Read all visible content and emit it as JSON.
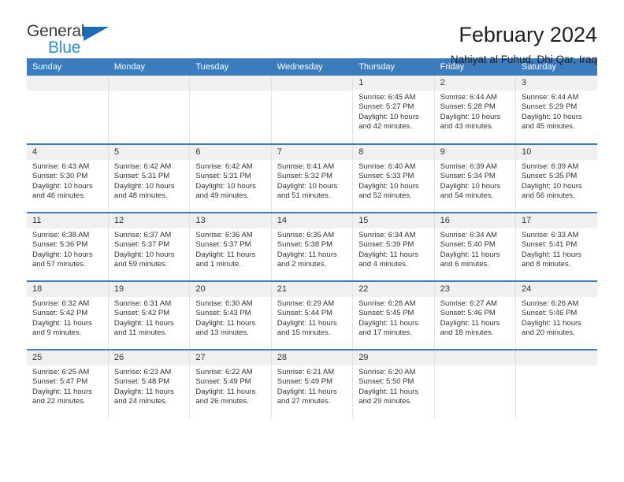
{
  "brand": {
    "name_top": "General",
    "name_bottom": "Blue",
    "accent_dark": "#1d6cb5",
    "accent_light": "#2b8fd8"
  },
  "header": {
    "title": "February 2024",
    "subtitle": "Nahiyat al Fuhud, Dhi Qar, Iraq"
  },
  "theme": {
    "header_blue": "#3a7cbe",
    "daynum_band": "#f0f0f0",
    "text": "#333333"
  },
  "calendar": {
    "weekday_headers": [
      "Sunday",
      "Monday",
      "Tuesday",
      "Wednesday",
      "Thursday",
      "Friday",
      "Saturday"
    ],
    "weeks": [
      [
        {
          "day": "",
          "empty": true
        },
        {
          "day": "",
          "empty": true
        },
        {
          "day": "",
          "empty": true
        },
        {
          "day": "",
          "empty": true
        },
        {
          "day": "1",
          "sunrise": "Sunrise: 6:45 AM",
          "sunset": "Sunset: 5:27 PM",
          "daylight": "Daylight: 10 hours and 42 minutes."
        },
        {
          "day": "2",
          "sunrise": "Sunrise: 6:44 AM",
          "sunset": "Sunset: 5:28 PM",
          "daylight": "Daylight: 10 hours and 43 minutes."
        },
        {
          "day": "3",
          "sunrise": "Sunrise: 6:44 AM",
          "sunset": "Sunset: 5:29 PM",
          "daylight": "Daylight: 10 hours and 45 minutes."
        }
      ],
      [
        {
          "day": "4",
          "sunrise": "Sunrise: 6:43 AM",
          "sunset": "Sunset: 5:30 PM",
          "daylight": "Daylight: 10 hours and 46 minutes."
        },
        {
          "day": "5",
          "sunrise": "Sunrise: 6:42 AM",
          "sunset": "Sunset: 5:31 PM",
          "daylight": "Daylight: 10 hours and 48 minutes."
        },
        {
          "day": "6",
          "sunrise": "Sunrise: 6:42 AM",
          "sunset": "Sunset: 5:31 PM",
          "daylight": "Daylight: 10 hours and 49 minutes."
        },
        {
          "day": "7",
          "sunrise": "Sunrise: 6:41 AM",
          "sunset": "Sunset: 5:32 PM",
          "daylight": "Daylight: 10 hours and 51 minutes."
        },
        {
          "day": "8",
          "sunrise": "Sunrise: 6:40 AM",
          "sunset": "Sunset: 5:33 PM",
          "daylight": "Daylight: 10 hours and 52 minutes."
        },
        {
          "day": "9",
          "sunrise": "Sunrise: 6:39 AM",
          "sunset": "Sunset: 5:34 PM",
          "daylight": "Daylight: 10 hours and 54 minutes."
        },
        {
          "day": "10",
          "sunrise": "Sunrise: 6:39 AM",
          "sunset": "Sunset: 5:35 PM",
          "daylight": "Daylight: 10 hours and 56 minutes."
        }
      ],
      [
        {
          "day": "11",
          "sunrise": "Sunrise: 6:38 AM",
          "sunset": "Sunset: 5:36 PM",
          "daylight": "Daylight: 10 hours and 57 minutes."
        },
        {
          "day": "12",
          "sunrise": "Sunrise: 6:37 AM",
          "sunset": "Sunset: 5:37 PM",
          "daylight": "Daylight: 10 hours and 59 minutes."
        },
        {
          "day": "13",
          "sunrise": "Sunrise: 6:36 AM",
          "sunset": "Sunset: 5:37 PM",
          "daylight": "Daylight: 11 hours and 1 minute."
        },
        {
          "day": "14",
          "sunrise": "Sunrise: 6:35 AM",
          "sunset": "Sunset: 5:38 PM",
          "daylight": "Daylight: 11 hours and 2 minutes."
        },
        {
          "day": "15",
          "sunrise": "Sunrise: 6:34 AM",
          "sunset": "Sunset: 5:39 PM",
          "daylight": "Daylight: 11 hours and 4 minutes."
        },
        {
          "day": "16",
          "sunrise": "Sunrise: 6:34 AM",
          "sunset": "Sunset: 5:40 PM",
          "daylight": "Daylight: 11 hours and 6 minutes."
        },
        {
          "day": "17",
          "sunrise": "Sunrise: 6:33 AM",
          "sunset": "Sunset: 5:41 PM",
          "daylight": "Daylight: 11 hours and 8 minutes."
        }
      ],
      [
        {
          "day": "18",
          "sunrise": "Sunrise: 6:32 AM",
          "sunset": "Sunset: 5:42 PM",
          "daylight": "Daylight: 11 hours and 9 minutes."
        },
        {
          "day": "19",
          "sunrise": "Sunrise: 6:31 AM",
          "sunset": "Sunset: 5:42 PM",
          "daylight": "Daylight: 11 hours and 11 minutes."
        },
        {
          "day": "20",
          "sunrise": "Sunrise: 6:30 AM",
          "sunset": "Sunset: 5:43 PM",
          "daylight": "Daylight: 11 hours and 13 minutes."
        },
        {
          "day": "21",
          "sunrise": "Sunrise: 6:29 AM",
          "sunset": "Sunset: 5:44 PM",
          "daylight": "Daylight: 11 hours and 15 minutes."
        },
        {
          "day": "22",
          "sunrise": "Sunrise: 6:28 AM",
          "sunset": "Sunset: 5:45 PM",
          "daylight": "Daylight: 11 hours and 17 minutes."
        },
        {
          "day": "23",
          "sunrise": "Sunrise: 6:27 AM",
          "sunset": "Sunset: 5:46 PM",
          "daylight": "Daylight: 11 hours and 18 minutes."
        },
        {
          "day": "24",
          "sunrise": "Sunrise: 6:26 AM",
          "sunset": "Sunset: 5:46 PM",
          "daylight": "Daylight: 11 hours and 20 minutes."
        }
      ],
      [
        {
          "day": "25",
          "sunrise": "Sunrise: 6:25 AM",
          "sunset": "Sunset: 5:47 PM",
          "daylight": "Daylight: 11 hours and 22 minutes."
        },
        {
          "day": "26",
          "sunrise": "Sunrise: 6:23 AM",
          "sunset": "Sunset: 5:48 PM",
          "daylight": "Daylight: 11 hours and 24 minutes."
        },
        {
          "day": "27",
          "sunrise": "Sunrise: 6:22 AM",
          "sunset": "Sunset: 5:49 PM",
          "daylight": "Daylight: 11 hours and 26 minutes."
        },
        {
          "day": "28",
          "sunrise": "Sunrise: 6:21 AM",
          "sunset": "Sunset: 5:49 PM",
          "daylight": "Daylight: 11 hours and 27 minutes."
        },
        {
          "day": "29",
          "sunrise": "Sunrise: 6:20 AM",
          "sunset": "Sunset: 5:50 PM",
          "daylight": "Daylight: 11 hours and 29 minutes."
        },
        {
          "day": "",
          "empty": true
        },
        {
          "day": "",
          "empty": true
        }
      ]
    ]
  }
}
